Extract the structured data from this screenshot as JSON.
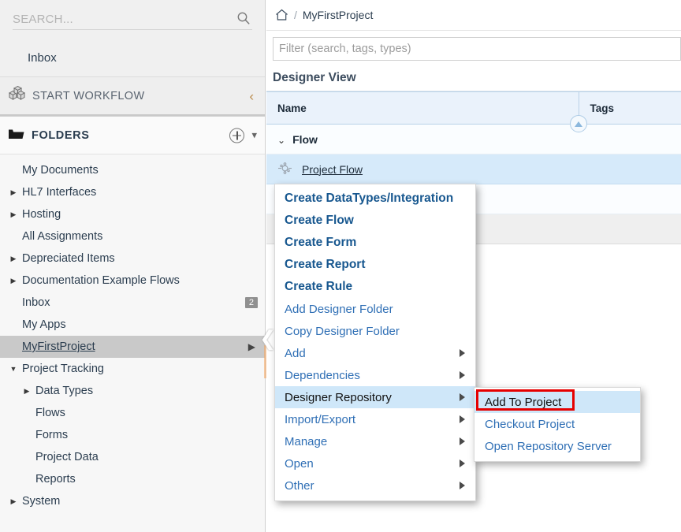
{
  "sidebar": {
    "search": {
      "placeholder": "SEARCH...",
      "value": "",
      "icon": "search-icon"
    },
    "inbox_top_label": "Inbox",
    "start_workflow": {
      "label": "START WORKFLOW",
      "icon": "cubes-icon",
      "chevron": "‹"
    },
    "folders_section": {
      "label": "FOLDERS",
      "icon": "folder-icon",
      "add_icon": "plus-circle-icon",
      "caret": "⌄"
    },
    "tree": [
      {
        "label": "My Documents",
        "arrow": "",
        "indent": 1
      },
      {
        "label": "HL7 Interfaces",
        "arrow": "▶",
        "indent": 1
      },
      {
        "label": "Hosting",
        "arrow": "▶",
        "indent": 1
      },
      {
        "label": "All Assignments",
        "arrow": "",
        "indent": 1
      },
      {
        "label": "Depreciated Items",
        "arrow": "▶",
        "indent": 1
      },
      {
        "label": "Documentation Example Flows",
        "arrow": "▶",
        "indent": 1
      },
      {
        "label": "Inbox",
        "arrow": "",
        "indent": 1,
        "badge": "2"
      },
      {
        "label": "My Apps",
        "arrow": "",
        "indent": 1
      },
      {
        "label": "MyFirstProject",
        "arrow": "",
        "indent": 1,
        "selected": true,
        "right_arrow": "▶"
      },
      {
        "label": "Project Tracking",
        "arrow": "▼",
        "indent": 1
      },
      {
        "label": "Data Types",
        "arrow": "▶",
        "indent": 2
      },
      {
        "label": "Flows",
        "arrow": "",
        "indent": 2
      },
      {
        "label": "Forms",
        "arrow": "",
        "indent": 2
      },
      {
        "label": "Project Data",
        "arrow": "",
        "indent": 2
      },
      {
        "label": "Reports",
        "arrow": "",
        "indent": 2
      },
      {
        "label": "System",
        "arrow": "▶",
        "indent": 1
      }
    ]
  },
  "main": {
    "breadcrumb": {
      "home_icon": "home-icon",
      "separator": "/",
      "current": "MyFirstProject"
    },
    "filter": {
      "placeholder": "Filter (search, tags, types)",
      "value": ""
    },
    "section_title": "Designer View",
    "table": {
      "columns": [
        "Name",
        "Tags"
      ],
      "group_row": {
        "chevron": "⌄",
        "label": "Flow"
      },
      "rows": [
        {
          "name": "Project Flow",
          "tags": "",
          "icon": "flow-icon",
          "selected": true
        }
      ]
    }
  },
  "context_menu": {
    "items": [
      {
        "label": "Create DataTypes/Integration",
        "bold": true
      },
      {
        "label": "Create Flow",
        "bold": true
      },
      {
        "label": "Create Form",
        "bold": true
      },
      {
        "label": "Create Report",
        "bold": true
      },
      {
        "label": "Create Rule",
        "bold": true
      },
      {
        "label": "Add Designer Folder",
        "bold": false
      },
      {
        "label": "Copy Designer Folder",
        "bold": false
      },
      {
        "label": "Add",
        "bold": false,
        "submenu": true
      },
      {
        "label": "Dependencies",
        "bold": false,
        "submenu": true
      },
      {
        "label": "Designer Repository",
        "bold": false,
        "submenu": true,
        "highlighted": true
      },
      {
        "label": "Import/Export",
        "bold": false,
        "submenu": true
      },
      {
        "label": "Manage",
        "bold": false,
        "submenu": true
      },
      {
        "label": "Open",
        "bold": false,
        "submenu": true
      },
      {
        "label": "Other",
        "bold": false,
        "submenu": true
      }
    ]
  },
  "submenu": {
    "items": [
      {
        "label": "Add To Project",
        "highlighted": true,
        "annotated": true
      },
      {
        "label": "Checkout Project",
        "highlighted": false
      },
      {
        "label": "Open Repository Server",
        "highlighted": false
      }
    ]
  },
  "colors": {
    "accent_blue": "#2f6fb5",
    "menu_highlight": "#cfe7f9",
    "row_selected": "#d6eafa",
    "annotation_red": "#e60000",
    "sidebar_bg": "#f7f7f7",
    "header_bg": "#eaf2fb"
  }
}
